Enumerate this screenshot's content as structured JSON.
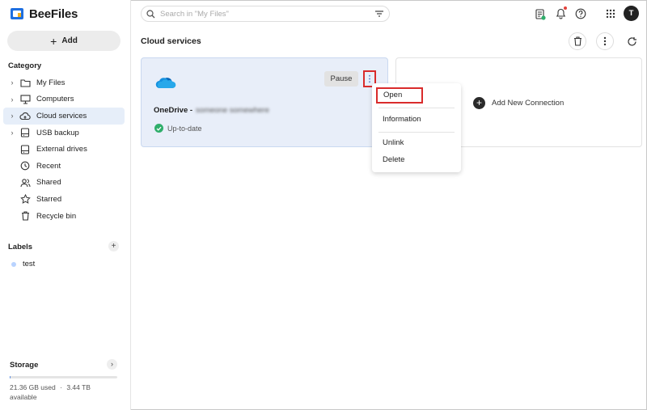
{
  "app": {
    "name": "BeeFiles"
  },
  "sidebar": {
    "add_label": "Add",
    "category_title": "Category",
    "items": [
      {
        "label": "My Files",
        "icon": "folder-icon",
        "expandable": true
      },
      {
        "label": "Computers",
        "icon": "monitor-icon",
        "expandable": true
      },
      {
        "label": "Cloud services",
        "icon": "cloud-icon",
        "expandable": true,
        "active": true
      },
      {
        "label": "USB backup",
        "icon": "usb-drive-icon",
        "expandable": true
      },
      {
        "label": "External drives",
        "icon": "external-drive-icon",
        "expandable": false
      },
      {
        "label": "Recent",
        "icon": "clock-icon",
        "expandable": false
      },
      {
        "label": "Shared",
        "icon": "people-icon",
        "expandable": false
      },
      {
        "label": "Starred",
        "icon": "star-icon",
        "expandable": false
      },
      {
        "label": "Recycle bin",
        "icon": "trash-icon",
        "expandable": false
      }
    ],
    "labels_title": "Labels",
    "labels": [
      {
        "name": "test",
        "color": "#b9d3ff"
      }
    ],
    "storage": {
      "title": "Storage",
      "used_text": "21.36 GB used",
      "separator": "·",
      "available_text": "3.44 TB available",
      "used_fraction": 0.006
    }
  },
  "topbar": {
    "search_placeholder": "Search in \"My Files\"",
    "avatar_initial": "T"
  },
  "main": {
    "title": "Cloud services",
    "card": {
      "service": "OneDrive -",
      "account": "someone somewhere",
      "pause_label": "Pause",
      "status": "Up-to-date"
    },
    "add_connection_label": "Add New Connection",
    "menu": {
      "open": "Open",
      "information": "Information",
      "unlink": "Unlink",
      "delete": "Delete"
    }
  },
  "colors": {
    "accent": "#0078d4",
    "highlight_box": "#d92b2b",
    "card_bg": "#e8eef9",
    "status_ok": "#2fae6b"
  }
}
